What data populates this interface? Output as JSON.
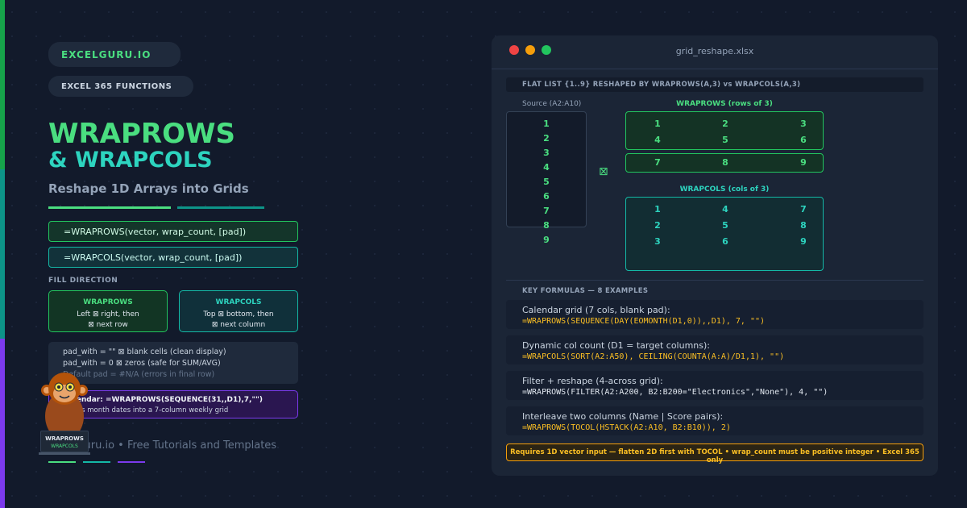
{
  "brand": "EXCELGURU.IO",
  "category": "EXCEL 365 FUNCTIONS",
  "title_line1": "WRAPROWS",
  "title_line2": "& WRAPCOLS",
  "subtitle": "Reshape 1D Arrays into Grids",
  "syntax": [
    "=WRAPROWS(vector, wrap_count, [pad])",
    "=WRAPCOLS(vector, wrap_count, [pad])"
  ],
  "fill_direction": {
    "heading": "FILL DIRECTION",
    "wraprows": {
      "title": "WRAPROWS",
      "line1": "Left ⊠ right, then",
      "line2": "⊠ next row"
    },
    "wrapcols": {
      "title": "WRAPCOLS",
      "line1": "Top ⊠ bottom, then",
      "line2": "⊠ next column"
    }
  },
  "pad_notes": [
    "pad_with = \"\" ⊠ blank cells (clean display)",
    "pad_with = 0 ⊠ zeros (safe for SUM/AVG)",
    "Default pad = #N/A (errors in final row)"
  ],
  "calendar_tip": {
    "title": "Calendar: =WRAPROWS(SEQUENCE(31,,D1),7,\"\")",
    "desc": "Wraps month dates into a 7-column weekly grid"
  },
  "mascot": {
    "line1": "WRAPROWS",
    "line2": "WRAPCOLS"
  },
  "footer": "ExcelGuru.io • Free Tutorials and Templates",
  "window": {
    "filename": "grid_reshape.xlsx",
    "header": "FLAT LIST {1..9} RESHAPED BY WRAPROWS(A,3) vs WRAPCOLS(A,3)",
    "source_label": "Source (A2:A10)",
    "source_values": [
      "1",
      "2",
      "3",
      "4",
      "5",
      "6",
      "7",
      "8",
      "9"
    ],
    "arrow_glyph": "⊠",
    "wraprows_label": "WRAPROWS (rows of 3)",
    "wraprows_rows": [
      [
        "1",
        "2",
        "3"
      ],
      [
        "4",
        "5",
        "6"
      ],
      [
        "7",
        "8",
        "9"
      ]
    ],
    "wrapcols_label": "WRAPCOLS (cols of 3)",
    "wrapcols_rows": [
      [
        "1",
        "4",
        "7"
      ],
      [
        "2",
        "5",
        "8"
      ],
      [
        "3",
        "6",
        "9"
      ]
    ],
    "formulas_heading": "KEY FORMULAS — 8 EXAMPLES",
    "formulas": [
      {
        "desc": "Calendar grid (7 cols, blank pad):",
        "formula": "=WRAPROWS(SEQUENCE(DAY(EOMONTH(D1,0)),,D1), 7, \"\")"
      },
      {
        "desc": "Dynamic col count (D1 = target columns):",
        "formula": "=WRAPCOLS(SORT(A2:A50), CEILING(COUNTA(A:A)/D1,1), \"\")"
      },
      {
        "desc": "Filter + reshape (4-across grid):",
        "formula": "=WRAPROWS(FILTER(A2:A200, B2:B200=\"Electronics\",\"None\"), 4, \"\")"
      },
      {
        "desc": "Interleave two columns (Name | Score pairs):",
        "formula": "=WRAPROWS(TOCOL(HSTACK(A2:A10, B2:B10)), 2)"
      }
    ],
    "warning": "Requires 1D vector input — flatten 2D first with TOCOL • wrap_count must be positive integer • Excel 365 only"
  },
  "colors": {
    "green": "#4ade80",
    "teal": "#2dd4bf",
    "purple": "#7c3aed",
    "amber": "#fbbf24"
  }
}
